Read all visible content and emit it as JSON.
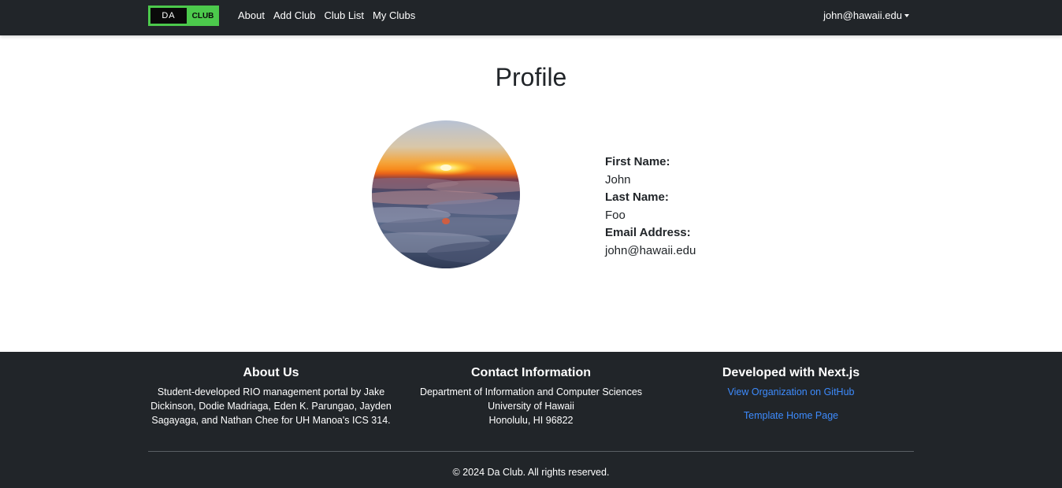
{
  "navbar": {
    "brand": {
      "left": "DA",
      "right": "CLUB"
    },
    "links": [
      "About",
      "Add Club",
      "Club List",
      "My Clubs"
    ],
    "user": "john@hawaii.edu"
  },
  "main": {
    "title": "Profile",
    "fields": [
      {
        "label": "First Name:",
        "value": "John"
      },
      {
        "label": "Last Name:",
        "value": "Foo"
      },
      {
        "label": "Email Address:",
        "value": "john@hawaii.edu"
      }
    ]
  },
  "footer": {
    "about": {
      "title": "About Us",
      "lines": [
        "Student-developed RIO management portal by Jake",
        "Dickinson, Dodie Madriaga, Eden K. Parungao, Jayden",
        "Sagayaga, and Nathan Chee for UH Manoa's ICS 314."
      ]
    },
    "contact": {
      "title": "Contact Information",
      "lines": [
        "Department of Information and Computer Sciences",
        "University of Hawaii",
        "Honolulu, HI 96822"
      ]
    },
    "developed": {
      "title": "Developed with Next.js",
      "links": [
        "View Organization on GitHub",
        "Template Home Page"
      ]
    },
    "copyright": "© 2024 Da Club. All rights reserved."
  },
  "colors": {
    "navbar_bg": "#212529",
    "brand_green": "#4cc94c",
    "link_blue": "#3d8bfd"
  }
}
